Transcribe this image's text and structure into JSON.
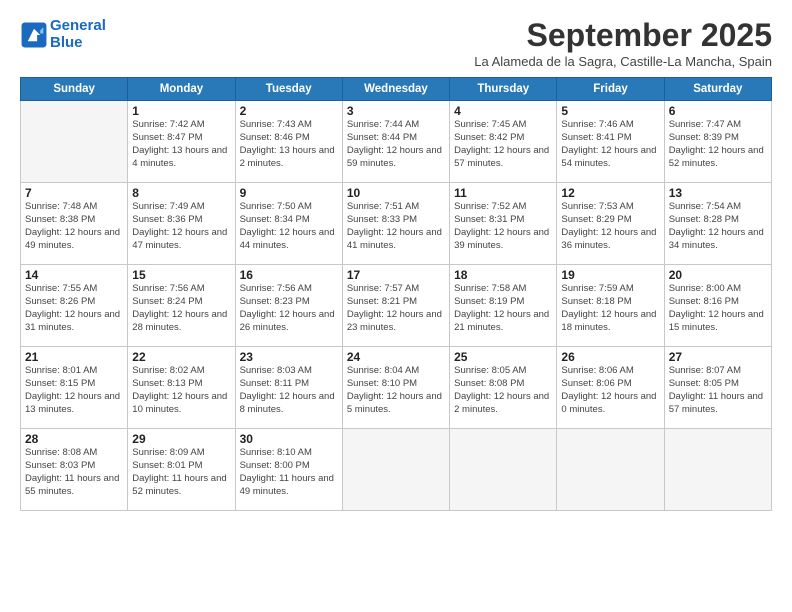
{
  "logo": {
    "line1": "General",
    "line2": "Blue"
  },
  "title": "September 2025",
  "subtitle": "La Alameda de la Sagra, Castille-La Mancha, Spain",
  "headers": [
    "Sunday",
    "Monday",
    "Tuesday",
    "Wednesday",
    "Thursday",
    "Friday",
    "Saturday"
  ],
  "weeks": [
    [
      {
        "day": "",
        "sunrise": "",
        "sunset": "",
        "daylight": ""
      },
      {
        "day": "1",
        "sunrise": "Sunrise: 7:42 AM",
        "sunset": "Sunset: 8:47 PM",
        "daylight": "Daylight: 13 hours and 4 minutes."
      },
      {
        "day": "2",
        "sunrise": "Sunrise: 7:43 AM",
        "sunset": "Sunset: 8:46 PM",
        "daylight": "Daylight: 13 hours and 2 minutes."
      },
      {
        "day": "3",
        "sunrise": "Sunrise: 7:44 AM",
        "sunset": "Sunset: 8:44 PM",
        "daylight": "Daylight: 12 hours and 59 minutes."
      },
      {
        "day": "4",
        "sunrise": "Sunrise: 7:45 AM",
        "sunset": "Sunset: 8:42 PM",
        "daylight": "Daylight: 12 hours and 57 minutes."
      },
      {
        "day": "5",
        "sunrise": "Sunrise: 7:46 AM",
        "sunset": "Sunset: 8:41 PM",
        "daylight": "Daylight: 12 hours and 54 minutes."
      },
      {
        "day": "6",
        "sunrise": "Sunrise: 7:47 AM",
        "sunset": "Sunset: 8:39 PM",
        "daylight": "Daylight: 12 hours and 52 minutes."
      }
    ],
    [
      {
        "day": "7",
        "sunrise": "Sunrise: 7:48 AM",
        "sunset": "Sunset: 8:38 PM",
        "daylight": "Daylight: 12 hours and 49 minutes."
      },
      {
        "day": "8",
        "sunrise": "Sunrise: 7:49 AM",
        "sunset": "Sunset: 8:36 PM",
        "daylight": "Daylight: 12 hours and 47 minutes."
      },
      {
        "day": "9",
        "sunrise": "Sunrise: 7:50 AM",
        "sunset": "Sunset: 8:34 PM",
        "daylight": "Daylight: 12 hours and 44 minutes."
      },
      {
        "day": "10",
        "sunrise": "Sunrise: 7:51 AM",
        "sunset": "Sunset: 8:33 PM",
        "daylight": "Daylight: 12 hours and 41 minutes."
      },
      {
        "day": "11",
        "sunrise": "Sunrise: 7:52 AM",
        "sunset": "Sunset: 8:31 PM",
        "daylight": "Daylight: 12 hours and 39 minutes."
      },
      {
        "day": "12",
        "sunrise": "Sunrise: 7:53 AM",
        "sunset": "Sunset: 8:29 PM",
        "daylight": "Daylight: 12 hours and 36 minutes."
      },
      {
        "day": "13",
        "sunrise": "Sunrise: 7:54 AM",
        "sunset": "Sunset: 8:28 PM",
        "daylight": "Daylight: 12 hours and 34 minutes."
      }
    ],
    [
      {
        "day": "14",
        "sunrise": "Sunrise: 7:55 AM",
        "sunset": "Sunset: 8:26 PM",
        "daylight": "Daylight: 12 hours and 31 minutes."
      },
      {
        "day": "15",
        "sunrise": "Sunrise: 7:56 AM",
        "sunset": "Sunset: 8:24 PM",
        "daylight": "Daylight: 12 hours and 28 minutes."
      },
      {
        "day": "16",
        "sunrise": "Sunrise: 7:56 AM",
        "sunset": "Sunset: 8:23 PM",
        "daylight": "Daylight: 12 hours and 26 minutes."
      },
      {
        "day": "17",
        "sunrise": "Sunrise: 7:57 AM",
        "sunset": "Sunset: 8:21 PM",
        "daylight": "Daylight: 12 hours and 23 minutes."
      },
      {
        "day": "18",
        "sunrise": "Sunrise: 7:58 AM",
        "sunset": "Sunset: 8:19 PM",
        "daylight": "Daylight: 12 hours and 21 minutes."
      },
      {
        "day": "19",
        "sunrise": "Sunrise: 7:59 AM",
        "sunset": "Sunset: 8:18 PM",
        "daylight": "Daylight: 12 hours and 18 minutes."
      },
      {
        "day": "20",
        "sunrise": "Sunrise: 8:00 AM",
        "sunset": "Sunset: 8:16 PM",
        "daylight": "Daylight: 12 hours and 15 minutes."
      }
    ],
    [
      {
        "day": "21",
        "sunrise": "Sunrise: 8:01 AM",
        "sunset": "Sunset: 8:15 PM",
        "daylight": "Daylight: 12 hours and 13 minutes."
      },
      {
        "day": "22",
        "sunrise": "Sunrise: 8:02 AM",
        "sunset": "Sunset: 8:13 PM",
        "daylight": "Daylight: 12 hours and 10 minutes."
      },
      {
        "day": "23",
        "sunrise": "Sunrise: 8:03 AM",
        "sunset": "Sunset: 8:11 PM",
        "daylight": "Daylight: 12 hours and 8 minutes."
      },
      {
        "day": "24",
        "sunrise": "Sunrise: 8:04 AM",
        "sunset": "Sunset: 8:10 PM",
        "daylight": "Daylight: 12 hours and 5 minutes."
      },
      {
        "day": "25",
        "sunrise": "Sunrise: 8:05 AM",
        "sunset": "Sunset: 8:08 PM",
        "daylight": "Daylight: 12 hours and 2 minutes."
      },
      {
        "day": "26",
        "sunrise": "Sunrise: 8:06 AM",
        "sunset": "Sunset: 8:06 PM",
        "daylight": "Daylight: 12 hours and 0 minutes."
      },
      {
        "day": "27",
        "sunrise": "Sunrise: 8:07 AM",
        "sunset": "Sunset: 8:05 PM",
        "daylight": "Daylight: 11 hours and 57 minutes."
      }
    ],
    [
      {
        "day": "28",
        "sunrise": "Sunrise: 8:08 AM",
        "sunset": "Sunset: 8:03 PM",
        "daylight": "Daylight: 11 hours and 55 minutes."
      },
      {
        "day": "29",
        "sunrise": "Sunrise: 8:09 AM",
        "sunset": "Sunset: 8:01 PM",
        "daylight": "Daylight: 11 hours and 52 minutes."
      },
      {
        "day": "30",
        "sunrise": "Sunrise: 8:10 AM",
        "sunset": "Sunset: 8:00 PM",
        "daylight": "Daylight: 11 hours and 49 minutes."
      },
      {
        "day": "",
        "sunrise": "",
        "sunset": "",
        "daylight": ""
      },
      {
        "day": "",
        "sunrise": "",
        "sunset": "",
        "daylight": ""
      },
      {
        "day": "",
        "sunrise": "",
        "sunset": "",
        "daylight": ""
      },
      {
        "day": "",
        "sunrise": "",
        "sunset": "",
        "daylight": ""
      }
    ]
  ]
}
